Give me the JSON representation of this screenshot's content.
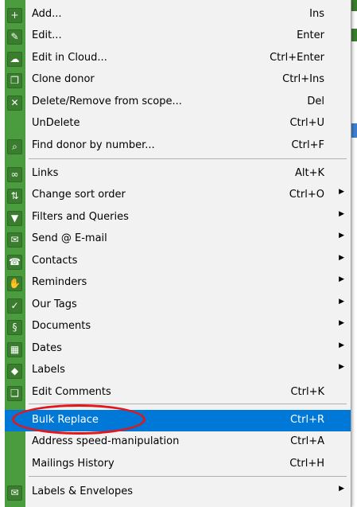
{
  "menu": {
    "items": [
      {
        "label": "Add...",
        "shortcut": "Ins",
        "submenu": false,
        "icon": "add-icon",
        "glyph": "+"
      },
      {
        "label": "Edit...",
        "shortcut": "Enter",
        "submenu": false,
        "icon": "edit-icon",
        "glyph": "✎"
      },
      {
        "label": "Edit in Cloud...",
        "shortcut": "Ctrl+Enter",
        "submenu": false,
        "icon": "cloud-edit-icon",
        "glyph": "☁"
      },
      {
        "label": "Clone donor",
        "shortcut": "Ctrl+Ins",
        "submenu": false,
        "icon": "clone-icon",
        "glyph": "❐"
      },
      {
        "label": "Delete/Remove from scope...",
        "shortcut": "Del",
        "submenu": false,
        "icon": "delete-icon",
        "glyph": "✕"
      },
      {
        "label": "UnDelete",
        "shortcut": "Ctrl+U",
        "submenu": false,
        "icon": "",
        "glyph": ""
      },
      {
        "label": "Find donor by number...",
        "shortcut": "Ctrl+F",
        "submenu": false,
        "icon": "search-icon",
        "glyph": "⌕"
      },
      {
        "label": "Links",
        "shortcut": "Alt+K",
        "submenu": false,
        "icon": "link-icon",
        "glyph": "∞"
      },
      {
        "label": "Change sort order",
        "shortcut": "Ctrl+O",
        "submenu": true,
        "icon": "sort-icon",
        "glyph": "⇅"
      },
      {
        "label": "Filters and Queries",
        "shortcut": "",
        "submenu": true,
        "icon": "filter-icon",
        "glyph": "▼"
      },
      {
        "label": "Send @ E-mail",
        "shortcut": "",
        "submenu": true,
        "icon": "email-icon",
        "glyph": "✉"
      },
      {
        "label": "Contacts",
        "shortcut": "",
        "submenu": true,
        "icon": "contacts-icon",
        "glyph": "☎"
      },
      {
        "label": "Reminders",
        "shortcut": "",
        "submenu": true,
        "icon": "reminder-icon",
        "glyph": "✋"
      },
      {
        "label": "Our Tags",
        "shortcut": "",
        "submenu": true,
        "icon": "tag-icon",
        "glyph": "✓"
      },
      {
        "label": "Documents",
        "shortcut": "",
        "submenu": true,
        "icon": "documents-icon",
        "glyph": "§"
      },
      {
        "label": "Dates",
        "shortcut": "",
        "submenu": true,
        "icon": "calendar-icon",
        "glyph": "▦"
      },
      {
        "label": "Labels",
        "shortcut": "",
        "submenu": true,
        "icon": "label-icon",
        "glyph": "◆"
      },
      {
        "label": "Edit Comments",
        "shortcut": "Ctrl+K",
        "submenu": false,
        "icon": "comments-icon",
        "glyph": "❑"
      },
      {
        "label": "Bulk Replace",
        "shortcut": "Ctrl+R",
        "submenu": false,
        "icon": "",
        "glyph": "",
        "selected": true
      },
      {
        "label": "Address speed-manipulation",
        "shortcut": "Ctrl+A",
        "submenu": false,
        "icon": "",
        "glyph": ""
      },
      {
        "label": "Mailings History",
        "shortcut": "Ctrl+H",
        "submenu": false,
        "icon": "",
        "glyph": ""
      },
      {
        "label": "Labels & Envelopes",
        "shortcut": "",
        "submenu": true,
        "icon": "envelope-icon",
        "glyph": "✉"
      }
    ]
  },
  "colors": {
    "gutter": "#4b9c3e",
    "selection": "#0078d7",
    "annotation": "#e2161b"
  }
}
